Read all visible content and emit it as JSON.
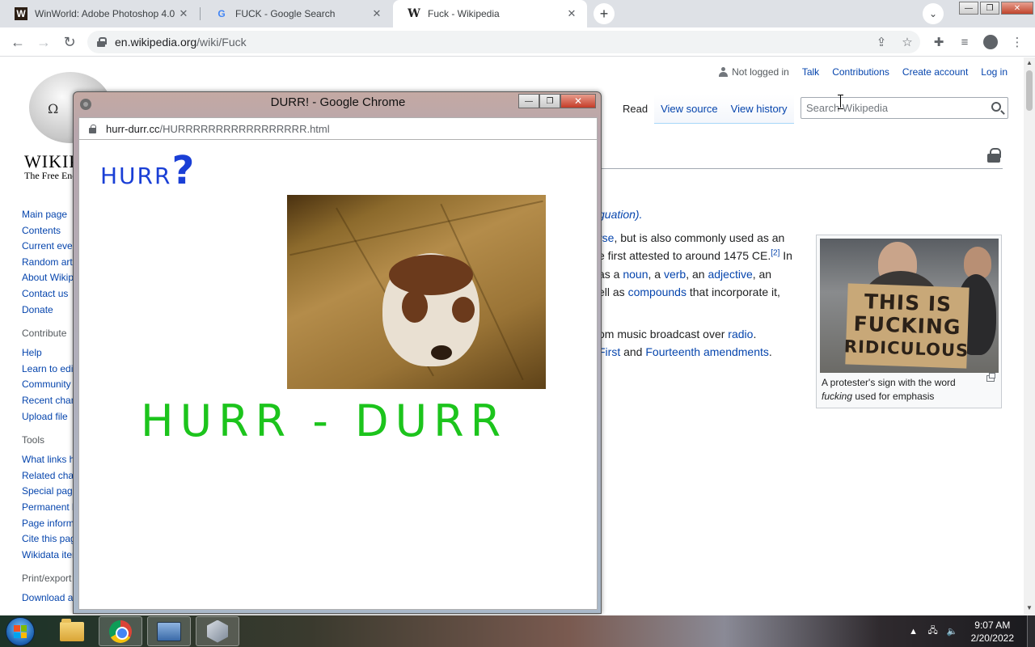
{
  "browser": {
    "tabs": [
      {
        "favicon": "W",
        "title": "WinWorld: Adobe Photoshop 4.0",
        "active": false
      },
      {
        "favicon": "G",
        "title": "FUCK - Google Search",
        "active": false
      },
      {
        "favicon": "W",
        "title": "Fuck - Wikipedia",
        "active": true
      }
    ],
    "url_host": "en.wikipedia.org",
    "url_path": "/wiki/Fuck"
  },
  "wiki": {
    "wordmark": "WIKIPEDIA",
    "tagline": "The Free Encyclopedia",
    "personal": {
      "not_logged_in": "Not logged in",
      "talk": "Talk",
      "contributions": "Contributions",
      "create_account": "Create account",
      "log_in": "Log in"
    },
    "views": {
      "read": "Read",
      "view_source": "View source",
      "view_history": "View history"
    },
    "search_placeholder": "Search Wikipedia",
    "sidebar": {
      "nav": [
        "Main page",
        "Contents",
        "Current events",
        "Random article",
        "About Wikipedia",
        "Contact us",
        "Donate"
      ],
      "contribute_head": "Contribute",
      "contribute": [
        "Help",
        "Learn to edit",
        "Community portal",
        "Recent changes",
        "Upload file"
      ],
      "tools_head": "Tools",
      "tools": [
        "What links here",
        "Related changes",
        "Special pages",
        "Permanent link",
        "Page information",
        "Cite this page",
        "Wikidata item"
      ],
      "print_head": "Print/export",
      "print": [
        "Download as PDF"
      ]
    },
    "content": {
      "l1_link": "guation).",
      "l2_link": "rse",
      "l2_text": ", but is also commonly used as an",
      "l3_text": "e first attested to around 1475 CE.",
      "l3_sup": "[2]",
      "l3_tail": " In",
      "l4_pre": " as a ",
      "l4_noun": "noun",
      "l4_sep1": ", a ",
      "l4_verb": "verb",
      "l4_sep2": ", an ",
      "l4_adj": "adjective",
      "l4_tail": ", an",
      "l5_pre": "ell as ",
      "l5_link": "compounds",
      "l5_tail": " that incorporate it,",
      "l6_pre": "om music broadcast over ",
      "l6_link": "radio",
      "l6_tail": ".",
      "l7_link1": "First",
      "l7_mid": " and ",
      "l7_link2": "Fourteenth amendments",
      "l7_tail": ".",
      "l8_text": "."
    },
    "thumb": {
      "sign_lines": [
        "THIS IS",
        "FUCKING",
        "RIDICULOUS"
      ],
      "caption_pre": "A protester's sign with the word ",
      "caption_it": "fucking",
      "caption_post": " used for emphasis"
    }
  },
  "popup": {
    "title": "DURR! - Google Chrome",
    "url_host": "hurr-durr.cc",
    "url_path": "/HURRRRRRRRRRRRRRRRR.html",
    "hurr_word": "HURR",
    "hurr_mark": "?",
    "banner": "HURR - DURR"
  },
  "taskbar": {
    "time": "9:07 AM",
    "date": "2/20/2022"
  }
}
